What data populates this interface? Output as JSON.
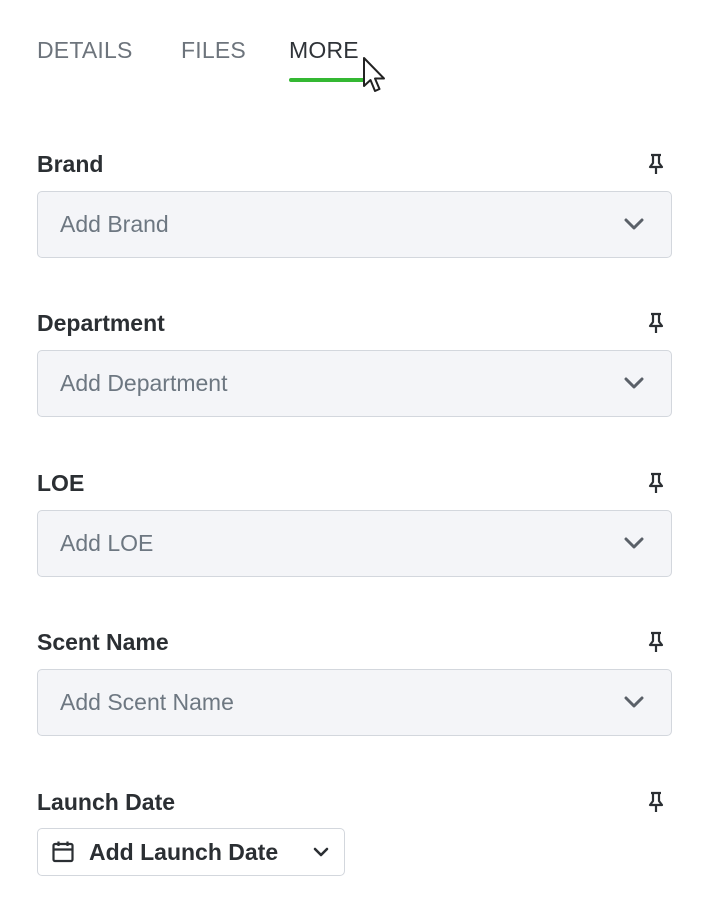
{
  "tabs": [
    {
      "label": "DETAILS",
      "active": false
    },
    {
      "label": "FILES",
      "active": false
    },
    {
      "label": "MORE",
      "active": true
    }
  ],
  "colors": {
    "active_underline": "#34b833",
    "select_background": "#f4f5f8",
    "border": "#d3d7dd",
    "placeholder_text": "#6d7781",
    "label_text": "#2b2f33"
  },
  "fields": [
    {
      "label": "Brand",
      "placeholder": "Add Brand",
      "icon": "pin-icon"
    },
    {
      "label": "Department",
      "placeholder": "Add Department",
      "icon": "pin-icon"
    },
    {
      "label": "LOE",
      "placeholder": "Add LOE",
      "icon": "pin-icon"
    },
    {
      "label": "Scent Name",
      "placeholder": "Add Scent Name",
      "icon": "pin-icon"
    }
  ],
  "launch_date": {
    "label": "Launch Date",
    "button_label": "Add Launch Date",
    "icon": "calendar-icon"
  }
}
